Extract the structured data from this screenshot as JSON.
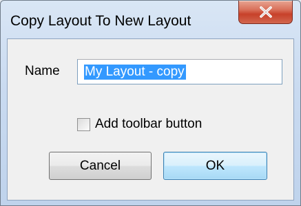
{
  "window": {
    "title": "Copy Layout To New Layout",
    "close_icon": "close-icon"
  },
  "form": {
    "name_label": "Name",
    "name_value": "My Layout - copy",
    "checkbox_label": "Add toolbar button",
    "checkbox_checked": false
  },
  "buttons": {
    "cancel_label": "Cancel",
    "ok_label": "OK"
  },
  "colors": {
    "selection": "#3399ff",
    "close_button": "#c7412a",
    "ok_button_border": "#3c7fb1"
  }
}
